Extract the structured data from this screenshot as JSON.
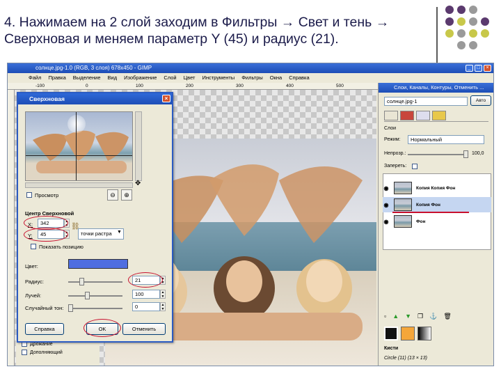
{
  "slide": {
    "title_line1": "4. Нажимаем на 2 слой заходим в Фильтры → Свет и тень →",
    "title_line2": "Сверхновая и меняем параметр Y (45) и радиус (21).",
    "dot_colors": [
      "#5b3a6e",
      "#5b3a6e",
      "#9a9a9a",
      "#5b3a6e",
      "#c8c84a",
      "#9a9a9a",
      "#5b3a6e",
      "#c8c84a",
      "#9a9a9a",
      "#c8c84a",
      "#c8c84a",
      "#9a9a9a",
      "#9a9a9a"
    ]
  },
  "gimp": {
    "window_title": "солнце.jpg-1.0 (RGB, 3 слоя) 678x450 - GIMP",
    "menu": [
      "Файл",
      "Правка",
      "Выделение",
      "Вид",
      "Изображение",
      "Слой",
      "Цвет",
      "Инструменты",
      "Фильтры",
      "Окна",
      "Справка"
    ],
    "ruler_marks": [
      "-100",
      "0",
      "100",
      "200",
      "300",
      "400",
      "500",
      "600",
      "700",
      "800"
    ],
    "tool_options": [
      "Дрожание",
      "Дополняющий"
    ]
  },
  "dialog": {
    "title": "Сверхновая",
    "preview_label": "Просмотр",
    "center_section": "Центр Сверхновой",
    "x_label": "X:",
    "x_value": "342",
    "y_label": "Y:",
    "y_value": "45",
    "units": "точки растра",
    "show_position": "Показать позицию",
    "color_label": "Цвет:",
    "color_value": "#4f6ee0",
    "radius_label": "Радиус:",
    "radius_value": "21",
    "rays_label": "Лучей:",
    "rays_value": "100",
    "random_hue_label": "Случайный тон:",
    "random_hue_value": "0",
    "help_button": "Справка",
    "ok_button": "OK",
    "cancel_button": "Отменить"
  },
  "dock": {
    "title": "Слои, Каналы, Контуры, Отменить ...",
    "image_select": "солнце.jpg-1",
    "auto_button": "Авто",
    "panel_label": "Слои",
    "mode_label": "Режим:",
    "mode_value": "Нормальный",
    "opacity_label": "Непрозр.:",
    "opacity_value": "100,0",
    "lock_label": "Запереть:",
    "layers": [
      "Копия Копия Фон",
      "Копия Фон",
      "Фон"
    ],
    "brushes_label": "Кисти",
    "brush_value": "Circle (11) (13 × 13)"
  }
}
